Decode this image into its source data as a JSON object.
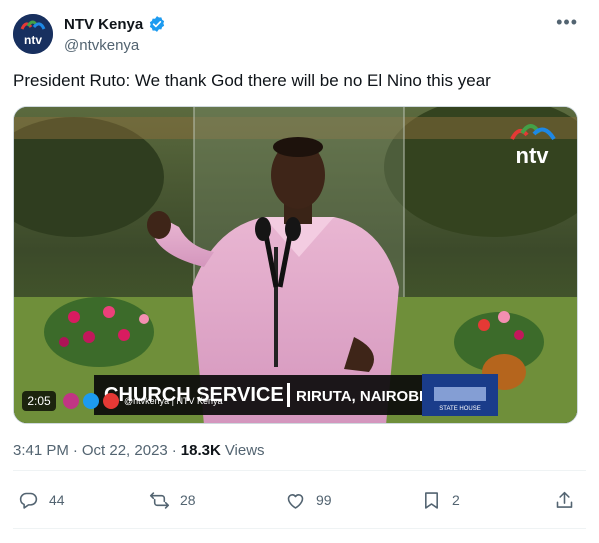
{
  "account": {
    "display_name": "NTV Kenya",
    "handle": "@ntvkenya",
    "avatar_text": "ntv",
    "verified": true
  },
  "tweet": {
    "text": "President Ruto: We thank God there will be no El Nino this year",
    "time": "3:41 PM",
    "separator": "·",
    "date": "Oct 22, 2023",
    "views_count": "18.3K",
    "views_label": "Views"
  },
  "video": {
    "logo_text": "ntv",
    "elapsed": "2:05",
    "social_handle": "@ntvkenya | NTV Kenya",
    "banner_title": "CHURCH SERVICE",
    "banner_location": "RIRUTA, NAIROBI.",
    "badge_text": "STATE HOUSE"
  },
  "actions": {
    "replies": "44",
    "reposts": "28",
    "likes": "99",
    "bookmarks": "2"
  },
  "colors": {
    "verified": "#1d9bf0",
    "muted": "#536471",
    "text": "#0f1419"
  }
}
